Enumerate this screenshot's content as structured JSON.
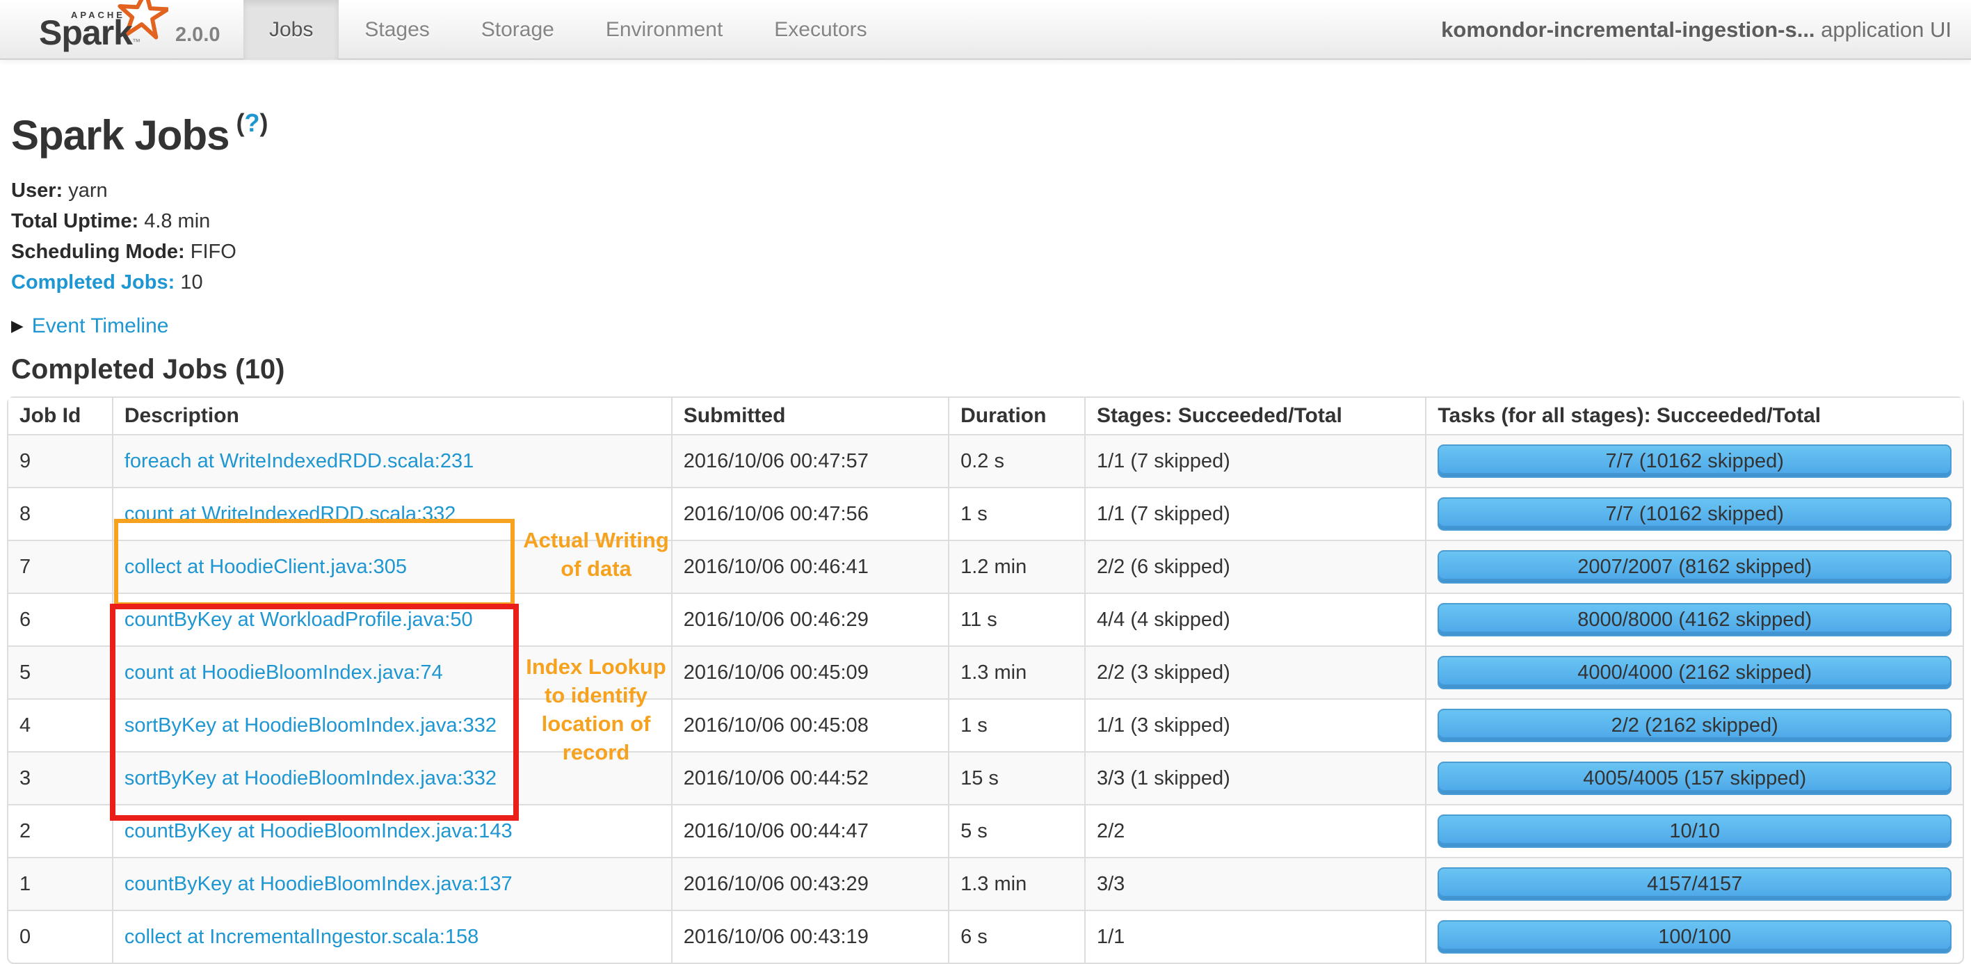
{
  "navbar": {
    "brand": {
      "apache": "APACHE",
      "name": "Spark",
      "tm": "™",
      "version": "2.0.0"
    },
    "tabs": [
      {
        "label": "Jobs",
        "active": true
      },
      {
        "label": "Stages",
        "active": false
      },
      {
        "label": "Storage",
        "active": false
      },
      {
        "label": "Environment",
        "active": false
      },
      {
        "label": "Executors",
        "active": false
      }
    ],
    "app_title": "komondor-incremental-ingestion-s...",
    "app_title_suffix": " application UI"
  },
  "page": {
    "title": "Spark Jobs",
    "help_open_paren": "(",
    "help_q": "?",
    "help_close_paren": ")",
    "info": [
      {
        "label": "User:",
        "value": "yarn"
      },
      {
        "label": "Total Uptime:",
        "value": "4.8 min"
      },
      {
        "label": "Scheduling Mode:",
        "value": "FIFO"
      },
      {
        "label": "Completed Jobs:",
        "value": "10"
      }
    ],
    "event_timeline_label": "Event Timeline",
    "caret_icon": "▶",
    "section_title": "Completed Jobs (10)"
  },
  "table": {
    "headers": [
      "Job Id",
      "Description",
      "Submitted",
      "Duration",
      "Stages: Succeeded/Total",
      "Tasks (for all stages): Succeeded/Total"
    ],
    "rows": [
      {
        "job_id": "9",
        "description": "foreach at WriteIndexedRDD.scala:231",
        "submitted": "2016/10/06 00:47:57",
        "duration": "0.2 s",
        "stages": "1/1 (7 skipped)",
        "tasks": "7/7 (10162 skipped)",
        "progress_pct": 100
      },
      {
        "job_id": "8",
        "description": "count at WriteIndexedRDD.scala:332",
        "submitted": "2016/10/06 00:47:56",
        "duration": "1 s",
        "stages": "1/1 (7 skipped)",
        "tasks": "7/7 (10162 skipped)",
        "progress_pct": 100
      },
      {
        "job_id": "7",
        "description": "collect at HoodieClient.java:305",
        "submitted": "2016/10/06 00:46:41",
        "duration": "1.2 min",
        "stages": "2/2 (6 skipped)",
        "tasks": "2007/2007 (8162 skipped)",
        "progress_pct": 100
      },
      {
        "job_id": "6",
        "description": "countByKey at WorkloadProfile.java:50",
        "submitted": "2016/10/06 00:46:29",
        "duration": "11 s",
        "stages": "4/4 (4 skipped)",
        "tasks": "8000/8000 (4162 skipped)",
        "progress_pct": 100
      },
      {
        "job_id": "5",
        "description": "count at HoodieBloomIndex.java:74",
        "submitted": "2016/10/06 00:45:09",
        "duration": "1.3 min",
        "stages": "2/2 (3 skipped)",
        "tasks": "4000/4000 (2162 skipped)",
        "progress_pct": 100
      },
      {
        "job_id": "4",
        "description": "sortByKey at HoodieBloomIndex.java:332",
        "submitted": "2016/10/06 00:45:08",
        "duration": "1 s",
        "stages": "1/1 (3 skipped)",
        "tasks": "2/2 (2162 skipped)",
        "progress_pct": 100
      },
      {
        "job_id": "3",
        "description": "sortByKey at HoodieBloomIndex.java:332",
        "submitted": "2016/10/06 00:44:52",
        "duration": "15 s",
        "stages": "3/3 (1 skipped)",
        "tasks": "4005/4005 (157 skipped)",
        "progress_pct": 100
      },
      {
        "job_id": "2",
        "description": "countByKey at HoodieBloomIndex.java:143",
        "submitted": "2016/10/06 00:44:47",
        "duration": "5 s",
        "stages": "2/2",
        "tasks": "10/10",
        "progress_pct": 100
      },
      {
        "job_id": "1",
        "description": "countByKey at HoodieBloomIndex.java:137",
        "submitted": "2016/10/06 00:43:29",
        "duration": "1.3 min",
        "stages": "3/3",
        "tasks": "4157/4157",
        "progress_pct": 100
      },
      {
        "job_id": "0",
        "description": "collect at IncrementalIngestor.scala:158",
        "submitted": "2016/10/06 00:43:19",
        "duration": "6 s",
        "stages": "1/1",
        "tasks": "100/100",
        "progress_pct": 100
      }
    ]
  },
  "annotations": {
    "writing_label": "Actual Writing of data",
    "lookup_label": "Index Lookup to identify location of record"
  },
  "colors": {
    "link_blue": "#1e96d2",
    "bar_top": "#69c4f3",
    "bar_bottom": "#4ba6e8",
    "bar_border": "#4a9dd4",
    "annotation_orange": "#f6a21f",
    "annotation_red": "#ea1f1a",
    "logo_orange": "#e2631f",
    "table_border": "#dddddd"
  }
}
